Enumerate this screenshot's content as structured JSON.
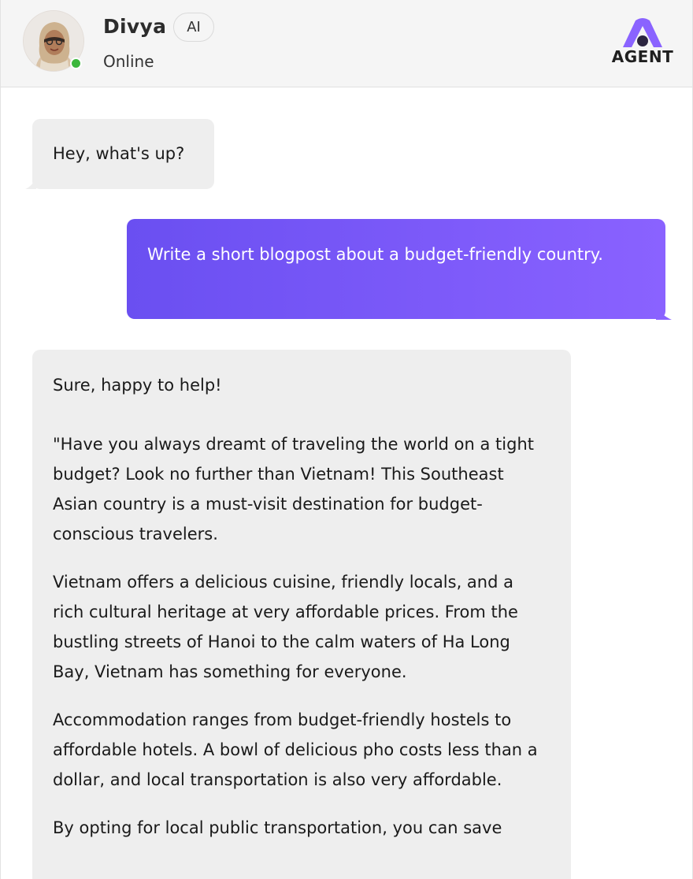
{
  "header": {
    "name": "Divya",
    "badge": "AI",
    "status": "Online",
    "logo_text": "AGENT"
  },
  "colors": {
    "accent": "#7b5bf7",
    "online": "#3cb73c",
    "incoming_bubble": "#eeeeee"
  },
  "icons": {
    "avatar": "avatar",
    "logo": "agent-logo"
  },
  "messages": [
    {
      "sender": "agent",
      "paragraphs": [
        "Hey, what's up?"
      ]
    },
    {
      "sender": "user",
      "paragraphs": [
        "Write a short blogpost about a budget-friendly country."
      ]
    },
    {
      "sender": "agent",
      "paragraphs": [
        "Sure, happy to help!",
        "\"Have you always dreamt of traveling the world on a tight budget? Look no further than Vietnam! This Southeast Asian country is a must-visit destination for budget-conscious travelers.",
        "Vietnam offers a delicious cuisine, friendly locals, and a rich cultural heritage at very affordable prices. From the bustling streets of Hanoi to the calm waters of Ha Long Bay, Vietnam has something for everyone.",
        "Accommodation ranges from budget-friendly hostels to affordable hotels. A bowl of delicious pho costs less than a dollar, and local transportation is also very affordable.",
        "By opting for local public transportation, you can save"
      ]
    }
  ]
}
